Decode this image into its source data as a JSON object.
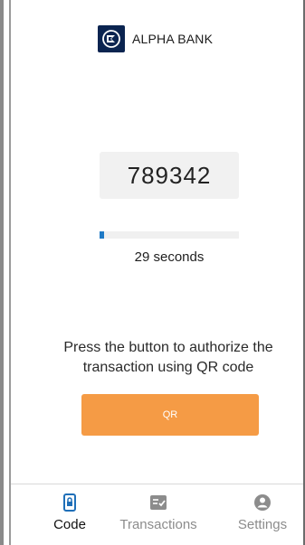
{
  "brand": {
    "name": "ALPHA BANK",
    "logo_icon": "alpha-bank-logo-icon",
    "color": "#0b2450"
  },
  "otp": {
    "code": "789342",
    "progress_percent": 3,
    "seconds_text": "29 seconds"
  },
  "authorize": {
    "message": "Press the button to authorize the transaction using QR code",
    "qr_button_label": "QR",
    "button_color": "#f59b45"
  },
  "tabs": [
    {
      "label": "Code",
      "icon": "phone-lock-icon",
      "active": true
    },
    {
      "label": "Transactions",
      "icon": "checklist-icon",
      "active": false
    },
    {
      "label": "Settings",
      "icon": "user-circle-icon",
      "active": false
    }
  ],
  "colors": {
    "progress": "#1f7ac6",
    "active_tab": "#111111",
    "inactive_tab": "#8c8c8c"
  }
}
